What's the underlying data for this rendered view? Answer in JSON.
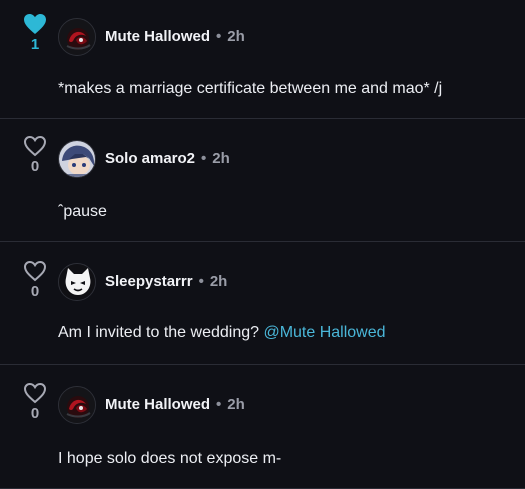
{
  "comments": [
    {
      "username": "Mute Hallowed",
      "separator": "•",
      "time": "2h",
      "likes": "1",
      "liked": true,
      "avatar": "dark-red-rose-avatar",
      "text": "*makes a marriage certificate between me and mao* /j",
      "mention": ""
    },
    {
      "username": "Solo amaro2",
      "separator": "•",
      "time": "2h",
      "likes": "0",
      "liked": false,
      "avatar": "anime-character-avatar",
      "text": "ˆpause",
      "mention": ""
    },
    {
      "username": "Sleepystarrr",
      "separator": "•",
      "time": "2h",
      "likes": "0",
      "liked": false,
      "avatar": "white-cat-avatar",
      "text": "Am I invited to the wedding? ",
      "mention": "@Mute Hallowed"
    },
    {
      "username": "Mute Hallowed",
      "separator": "•",
      "time": "2h",
      "likes": "0",
      "liked": false,
      "avatar": "dark-red-rose-avatar",
      "text": "I hope solo does not expose m-",
      "mention": ""
    }
  ],
  "colors": {
    "background": "#0f1016",
    "liked": "#2db8d6",
    "mention": "#4ab6d8",
    "divider": "#2a2c35"
  }
}
